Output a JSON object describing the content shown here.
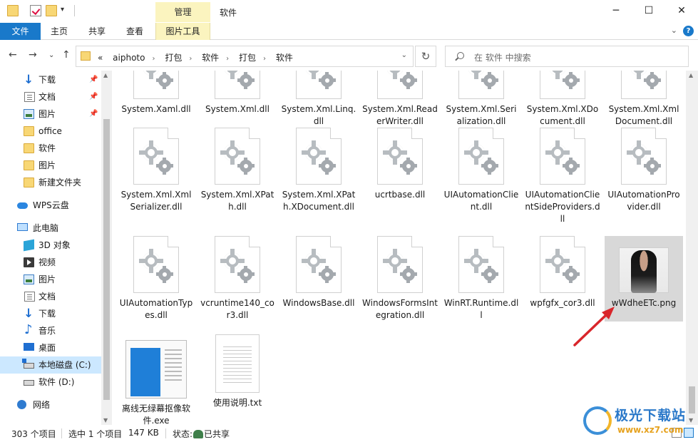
{
  "titlebar": {
    "manage_tab": "管理",
    "title": "软件",
    "min": "─",
    "max": "☐",
    "close": "✕"
  },
  "ribbon": {
    "tabs": [
      "文件",
      "主页",
      "共享",
      "查看",
      "图片工具"
    ],
    "expand_icon": "chevron-down-icon",
    "help": "?"
  },
  "address": {
    "crumbs": [
      "aiphoto",
      "打包",
      "软件",
      "打包",
      "软件"
    ],
    "prefix": "«",
    "search_placeholder": "在 软件 中搜索"
  },
  "sidebar": {
    "items": [
      {
        "label": "下载",
        "icon": "download-icon",
        "pinned": true
      },
      {
        "label": "文档",
        "icon": "document-icon",
        "pinned": true
      },
      {
        "label": "图片",
        "icon": "picture-icon",
        "pinned": true
      },
      {
        "label": "office",
        "icon": "folder-icon",
        "pinned": false
      },
      {
        "label": "软件",
        "icon": "folder-icon",
        "pinned": false
      },
      {
        "label": "图片",
        "icon": "folder-icon",
        "pinned": false
      },
      {
        "label": "新建文件夹",
        "icon": "folder-icon",
        "pinned": false
      },
      {
        "label": "WPS云盘",
        "icon": "cloud-icon",
        "pinned": false
      },
      {
        "label": "此电脑",
        "icon": "computer-icon",
        "pinned": false
      },
      {
        "label": "3D 对象",
        "icon": "3d-objects-icon",
        "pinned": false
      },
      {
        "label": "视频",
        "icon": "video-icon",
        "pinned": false
      },
      {
        "label": "图片",
        "icon": "picture-icon",
        "pinned": false
      },
      {
        "label": "文档",
        "icon": "document-icon",
        "pinned": false
      },
      {
        "label": "下载",
        "icon": "download-icon",
        "pinned": false
      },
      {
        "label": "音乐",
        "icon": "music-icon",
        "pinned": false
      },
      {
        "label": "桌面",
        "icon": "desktop-icon",
        "pinned": false
      },
      {
        "label": "本地磁盘 (C:)",
        "icon": "drive-c-icon",
        "pinned": false,
        "selected": true
      },
      {
        "label": "软件 (D:)",
        "icon": "drive-icon",
        "pinned": false
      },
      {
        "label": "网络",
        "icon": "network-icon",
        "pinned": false
      }
    ]
  },
  "files": {
    "row0": [
      "System.Xaml.dll",
      "System.Xml.dll",
      "System.Xml.Linq.dll",
      "System.Xml.ReaderWriter.dll",
      "System.Xml.Serialization.dll",
      "System.Xml.XDocument.dll",
      "System.Xml.XmlDocument.dll"
    ],
    "row1": [
      "System.Xml.XmlSerializer.dll",
      "System.Xml.XPath.dll",
      "System.Xml.XPath.XDocument.dll",
      "ucrtbase.dll",
      "UIAutomationClient.dll",
      "UIAutomationClientSideProviders.dll",
      "UIAutomationProvider.dll"
    ],
    "row2": [
      "UIAutomationTypes.dll",
      "vcruntime140_cor3.dll",
      "WindowsBase.dll",
      "WindowsFormsIntegration.dll",
      "WinRT.Runtime.dll",
      "wpfgfx_cor3.dll",
      "wWdheETc.png"
    ],
    "row3": [
      "离线无绿幕抠像软件.exe",
      "使用说明.txt"
    ]
  },
  "status": {
    "count": "303 个项目",
    "selected": "选中 1 个项目",
    "size": "147 KB",
    "state_label": "状态:",
    "state_value": "已共享"
  },
  "watermark": {
    "title": "极光下载站",
    "url": "www.xz7.com"
  },
  "colors": {
    "accent": "#1979ca",
    "tool_tab": "#fbf4bf",
    "selection": "#cce8ff",
    "arrow": "#d9262b"
  }
}
